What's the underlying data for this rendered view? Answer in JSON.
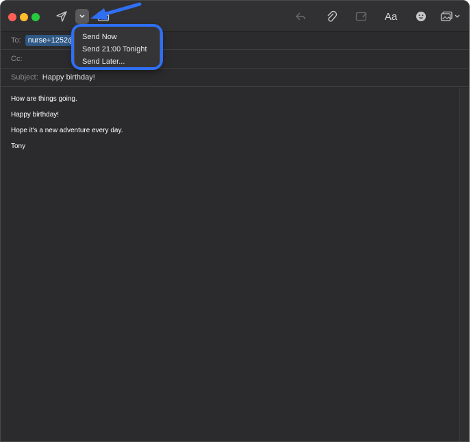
{
  "compose": {
    "to_label": "To:",
    "to_recipient": "nurse+1252@",
    "cc_label": "Cc:",
    "subject_label": "Subject:",
    "subject_value": "Happy birthday!"
  },
  "toolbar": {
    "format_label": "Aa",
    "icons": [
      "send-icon",
      "chevron-down-icon",
      "header-fields-icon",
      "reply-icon",
      "paperclip-icon",
      "markup-icon",
      "emoji-icon",
      "photo-browser-icon"
    ]
  },
  "send_menu": {
    "items": [
      "Send Now",
      "Send 21:00 Tonight",
      "Send Later..."
    ]
  },
  "message": {
    "lines": [
      "How are things going.",
      "Happy birthday!",
      "Hope it's a new adventure every day.",
      "Tony"
    ]
  },
  "colors": {
    "window_bg": "#2b2b2d",
    "annotation_blue": "#2f6ff4",
    "token_bg": "#2e5784"
  }
}
